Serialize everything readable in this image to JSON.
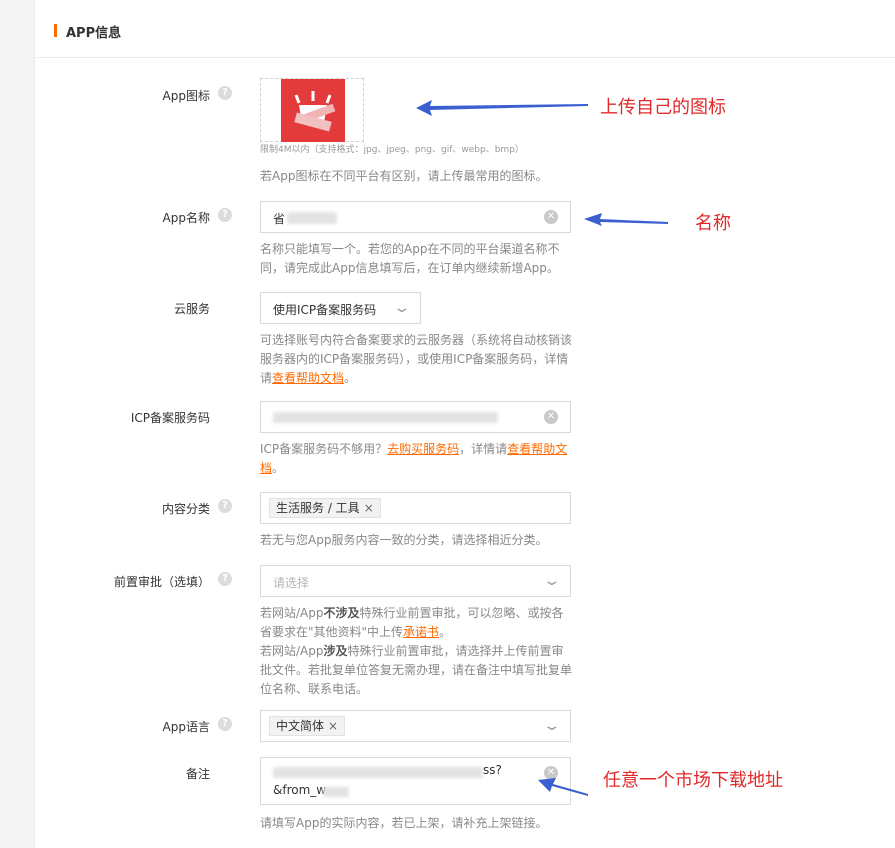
{
  "header": {
    "title": "APP信息"
  },
  "icon_field": {
    "label": "App图标",
    "upload_limit": "限制4M以内（支持格式：jpg、jpeg、png、gif、webp、bmp）",
    "hint": "若App图标在不同平台有区别，请上传最常用的图标。"
  },
  "name_field": {
    "label": "App名称",
    "value": "省",
    "hint": "名称只能填写一个。若您的App在不同的平台渠道名称不同，请完成此App信息填写后，在订单内继续新增App。"
  },
  "cloud_field": {
    "label": "云服务",
    "value": "使用ICP备案服务码",
    "hint_text": "可选择账号内符合备案要求的云服务器（系统将自动核销该服务器内的ICP备案服务码），或使用ICP备案服务码，详情请",
    "hint_link": "查看帮助文档",
    "hint_end": "。"
  },
  "icp_field": {
    "label": "ICP备案服务码",
    "hint_text": "ICP备案服务码不够用？",
    "hint_link1": "去购买服务码",
    "hint_mid": "，详情请",
    "hint_link2": "查看帮助文档",
    "hint_end": "。"
  },
  "category_field": {
    "label": "内容分类",
    "tag": "生活服务 / 工具",
    "hint": "若无与您App服务内容一致的分类，请选择相近分类。"
  },
  "preapproval_field": {
    "label": "前置审批（选填）",
    "placeholder": "请选择",
    "hint_a1": "若网站/App",
    "hint_a_bold": "不涉及",
    "hint_a2": "特殊行业前置审批，可以忽略、或按各省要求在\"其他资料\"中上传",
    "hint_a_link": "承诺书",
    "hint_a_end": "。",
    "hint_b1": "若网站/App",
    "hint_b_bold": "涉及",
    "hint_b2": "特殊行业前置审批，请选择并上传前置审批文件。若批复单位答复无需办理，请在备注中填写批复单位名称、联系电话。"
  },
  "language_field": {
    "label": "App语言",
    "tag": "中文简体"
  },
  "remark_field": {
    "label": "备注",
    "line1_end": "ss?",
    "line2": "&from_w",
    "hint": "请填写App的实际内容，若已上架，请补充上架链接。"
  },
  "annotations": {
    "upload_icon": "上传自己的图标",
    "name": "名称",
    "market_url": "任意一个市场下载地址",
    "color": "#e02a2a",
    "arrow_color": "#3b5fd0"
  },
  "accent_color": "#ff6a00"
}
